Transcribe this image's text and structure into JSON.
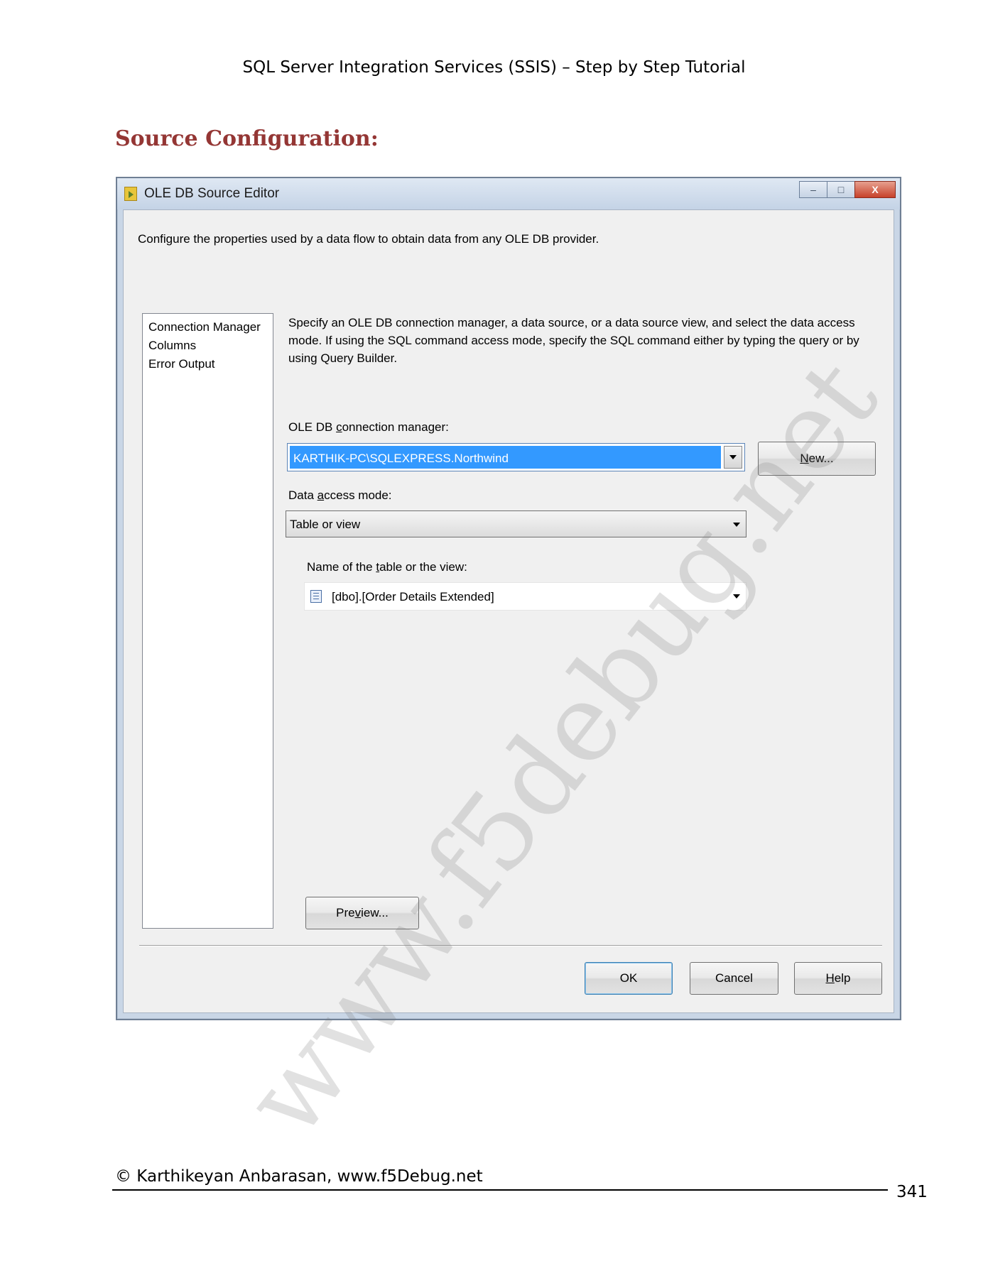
{
  "doc_header": "SQL Server Integration Services (SSIS) – Step by Step Tutorial",
  "section_heading": "Source Configuration:",
  "dialog": {
    "title": "OLE DB Source Editor",
    "window_buttons": {
      "minimize": "–",
      "maximize": "□",
      "close": "X"
    },
    "description": "Configure the properties used by a data flow to obtain data from any OLE DB provider.",
    "nav_items": [
      "Connection Manager",
      "Columns",
      "Error Output"
    ],
    "instructions": "Specify an OLE DB connection manager, a data source, or a data source view, and select the data access mode. If using the SQL command access mode, specify the SQL command either by typing the query or by using Query Builder.",
    "connection_manager": {
      "label_pre": "OLE DB ",
      "label_key": "c",
      "label_post": "onnection manager:",
      "value": "KARTHIK-PC\\SQLEXPRESS.Northwind",
      "new_pre": "",
      "new_key": "N",
      "new_post": "ew..."
    },
    "access_mode": {
      "label_pre": "Data ",
      "label_key": "a",
      "label_post": "ccess mode:",
      "value": "Table or view"
    },
    "table": {
      "label_pre": "Name of the ",
      "label_key": "t",
      "label_post": "able or the view:",
      "value": "[dbo].[Order Details Extended]"
    },
    "preview": {
      "pre": "Pre",
      "key": "v",
      "post": "iew..."
    },
    "ok": "OK",
    "cancel": "Cancel",
    "help": {
      "pre": "",
      "key": "H",
      "post": "elp"
    }
  },
  "watermark": "www.f5debug.net",
  "footer": "© Karthikeyan Anbarasan, www.f5Debug.net",
  "page_number": "341"
}
